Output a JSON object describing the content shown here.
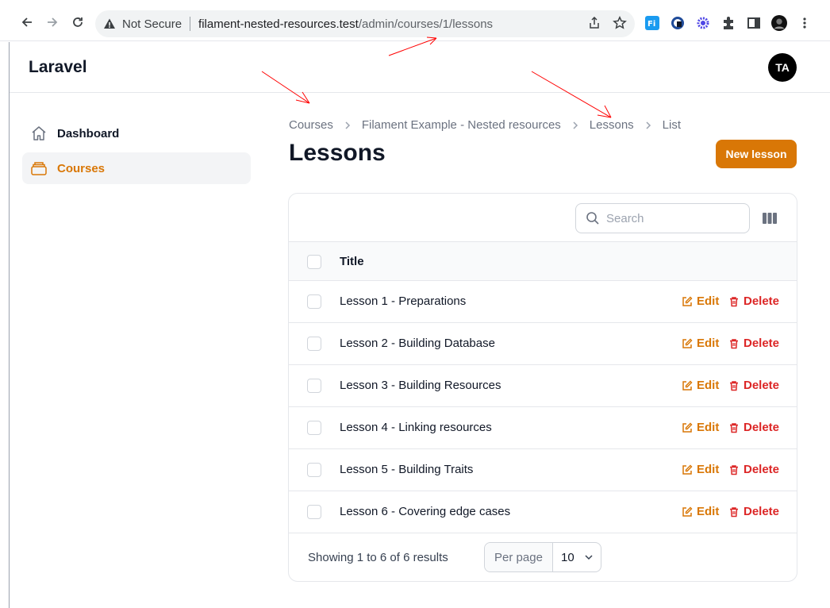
{
  "browser": {
    "security_label": "Not Secure",
    "url_host": "filament-nested-resources.test",
    "url_path": "/admin/courses/1/lessons"
  },
  "header": {
    "brand": "Laravel",
    "avatar_initials": "TA"
  },
  "sidebar": {
    "items": [
      {
        "label": "Dashboard",
        "icon": "home-icon",
        "active": false
      },
      {
        "label": "Courses",
        "icon": "collection-icon",
        "active": true
      }
    ]
  },
  "breadcrumb": [
    "Courses",
    "Filament Example - Nested resources",
    "Lessons",
    "List"
  ],
  "page": {
    "title": "Lessons",
    "new_button": "New lesson"
  },
  "table": {
    "search_placeholder": "Search",
    "column_title": "Title",
    "edit_label": "Edit",
    "delete_label": "Delete",
    "rows": [
      "Lesson 1 - Preparations",
      "Lesson 2 - Building Database",
      "Lesson 3 - Building Resources",
      "Lesson 4 - Linking resources",
      "Lesson 5 - Building Traits",
      "Lesson 6 - Covering edge cases"
    ],
    "footer_text": "Showing 1 to 6 of 6 results",
    "per_page_label": "Per page",
    "per_page_value": "10"
  },
  "colors": {
    "accent": "#d97706",
    "danger": "#dc2626",
    "annotation": "#ff0000"
  }
}
